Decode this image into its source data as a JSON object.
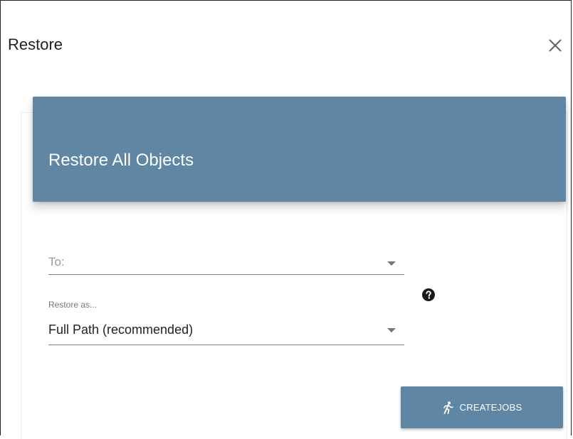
{
  "dialog": {
    "title": "Restore",
    "close_icon": "close-icon"
  },
  "card": {
    "header_title": "Restore All Objects",
    "header_color": "#5f86a3"
  },
  "form": {
    "to_field": {
      "placeholder": "To:",
      "value": ""
    },
    "restore_as_field": {
      "label": "Restore as...",
      "value": "Full Path (recommended)"
    },
    "help_icon": "question-circle-icon"
  },
  "actions": {
    "create_jobs_label": "CREATEJOBS",
    "create_jobs_icon": "running-person-icon",
    "button_color": "#5f86a3"
  }
}
